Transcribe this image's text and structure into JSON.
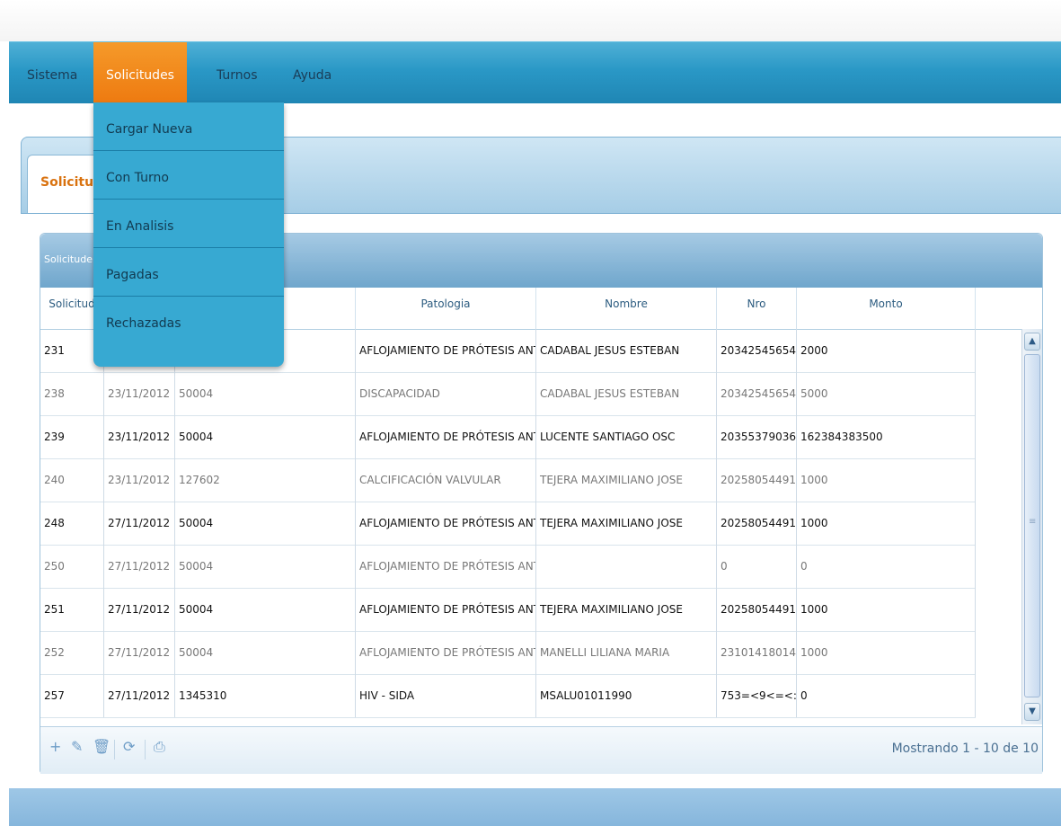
{
  "menu": {
    "items": [
      "Sistema",
      "Solicitudes",
      "Turnos",
      "Ayuda"
    ],
    "active": "Solicitudes"
  },
  "dropdown": [
    "Cargar Nueva",
    "Con Turno",
    "En Analisis",
    "Pagadas",
    "Rechazadas"
  ],
  "tab": {
    "label": "Solicitu"
  },
  "grid": {
    "caption": "Solicitude",
    "headers": [
      "Solicitud",
      "",
      "a",
      "Patologia",
      "Nombre",
      "Nro",
      "Monto"
    ],
    "rows": [
      [
        "231",
        "",
        "",
        "AFLOJAMIENTO DE PRÓTESIS ANT",
        "CADABAL JESUS ESTEBAN",
        "20342545654",
        "2000"
      ],
      [
        "238",
        "23/11/2012",
        "50004",
        "DISCAPACIDAD",
        "CADABAL JESUS ESTEBAN",
        "20342545654",
        "5000"
      ],
      [
        "239",
        "23/11/2012",
        "50004",
        "AFLOJAMIENTO DE PRÓTESIS ANT",
        "LUCENTE SANTIAGO OSC",
        "20355379036",
        "162384383500"
      ],
      [
        "240",
        "23/11/2012",
        "127602",
        "CALCIFICACIÓN VALVULAR",
        "TEJERA MAXIMILIANO JOSE",
        "20258054491",
        "1000"
      ],
      [
        "248",
        "27/11/2012",
        "50004",
        "AFLOJAMIENTO DE PRÓTESIS ANT",
        "TEJERA MAXIMILIANO JOSE",
        "20258054491",
        "1000"
      ],
      [
        "250",
        "27/11/2012",
        "50004",
        "AFLOJAMIENTO DE PRÓTESIS ANT",
        "",
        "0",
        "0"
      ],
      [
        "251",
        "27/11/2012",
        "50004",
        "AFLOJAMIENTO DE PRÓTESIS ANT",
        "TEJERA MAXIMILIANO JOSE",
        "20258054491",
        "1000"
      ],
      [
        "252",
        "27/11/2012",
        "50004",
        "AFLOJAMIENTO DE PRÓTESIS ANT",
        "MANELLI LILIANA MARIA",
        "23101418014",
        "1000"
      ],
      [
        "257",
        "27/11/2012",
        "1345310",
        "HIV - SIDA",
        "MSALU01011990",
        "753=<9<=<:=",
        "0"
      ]
    ],
    "pager": "Mostrando 1 - 10 de 10"
  },
  "toolbar": [
    "add-icon",
    "edit-icon",
    "delete-icon",
    "refresh-icon",
    "print-icon"
  ],
  "colors": {
    "menu": "#2a98c6",
    "active": "#ee7a10",
    "tab_text": "#d9720f"
  }
}
